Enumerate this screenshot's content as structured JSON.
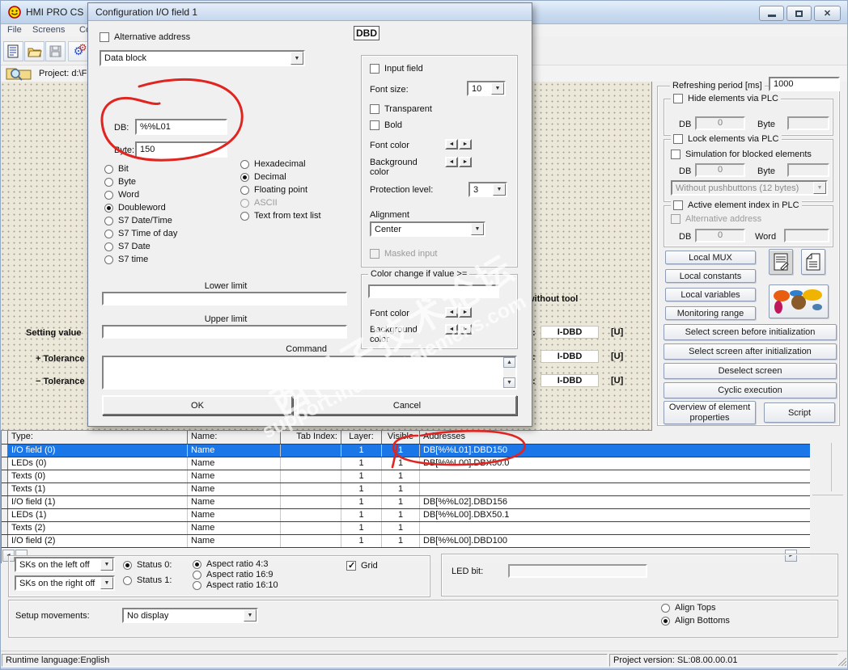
{
  "colors": {
    "highlight": "#1b76e8",
    "annotation": "#e02420",
    "canvas_bg": "#ebe8da",
    "titlebar": "#c9dbf0"
  },
  "window": {
    "title": "HMI PRO CS",
    "menu": [
      "File",
      "Screens",
      "Co"
    ],
    "project_label": "Project: d:\\F",
    "status_left": "Runtime language:English",
    "status_right": "Project version: SL:08.00.00.01"
  },
  "canvas": {
    "labels": [
      "Setting value",
      "+ Tolerance",
      "− Tolerance"
    ],
    "heading": "without tool",
    "colon": ":",
    "field_text": "I-DBD",
    "unit": "[U]"
  },
  "dialog": {
    "title": "Configuration I/O field 1",
    "alt_address": "Alternative address",
    "data_block": "Data block",
    "db_label": "DB:",
    "db_value": "%%L01",
    "byte_label": "Byte:",
    "byte_value": "150",
    "type_options": [
      "Bit",
      "Byte",
      "Word",
      "Doubleword",
      "S7 Date/Time",
      "S7 Time of day",
      "S7 Date",
      "S7 time"
    ],
    "format_options": [
      "Hexadecimal",
      "Decimal",
      "Floating point",
      "ASCII",
      "Text from text list"
    ],
    "lower_limit": "Lower limit",
    "upper_limit": "Upper limit",
    "command": "Command",
    "ok": "OK",
    "cancel": "Cancel",
    "preview": "DBD",
    "style": {
      "input_field": "Input field",
      "font_size": "Font size:",
      "font_size_value": "10",
      "transparent": "Transparent",
      "bold": "Bold",
      "font_color": "Font color",
      "background_color": "Background color",
      "protection": "Protection level:",
      "protection_value": "3",
      "alignment": "Alignment",
      "alignment_value": "Center",
      "masked": "Masked input"
    },
    "color_change": {
      "title": "Color change if value >=",
      "font_color": "Font color",
      "background_color": "Background color"
    }
  },
  "panel": {
    "refresh_label": "Refreshing period [ms]",
    "refresh_value": "1000",
    "hide_group": {
      "title": "Hide elements via PLC",
      "db": "DB",
      "db_value": "0",
      "byte": "Byte",
      "byte_value": ""
    },
    "lock_group": {
      "title": "Lock elements via PLC",
      "sim": "Simulation for blocked elements",
      "db": "DB",
      "db_value": "0",
      "byte": "Byte",
      "byte_value": "",
      "dropdown": "Without pushbuttons (12 bytes)"
    },
    "active_group": {
      "title": "Active element index in PLC",
      "alt": "Alternative address",
      "db": "DB",
      "db_value": "0",
      "word": "Word",
      "word_value": ""
    },
    "buttons": {
      "local_mux": "Local MUX",
      "local_constants": "Local constants",
      "local_variables": "Local variables",
      "monitoring_range": "Monitoring range",
      "select_before": "Select screen before initialization",
      "select_after": "Select screen after initialization",
      "deselect": "Deselect screen",
      "cyclic": "Cyclic execution",
      "overview": "Overview of element properties",
      "script": "Script"
    }
  },
  "table": {
    "headers": [
      "Type:",
      "Name:",
      "Tab Index:",
      "Layer:",
      "Visible",
      "Addresses"
    ],
    "rows": [
      {
        "type": "I/O field (0)",
        "name": "Name",
        "tab": "",
        "layer": "1",
        "visible": "1",
        "addr": "DB[%%L01].DBD150",
        "selected": true
      },
      {
        "type": "LEDs (0)",
        "name": "Name",
        "tab": "",
        "layer": "1",
        "visible": "1",
        "addr": "DB[%%L00].DBX50.0",
        "selected": false
      },
      {
        "type": "Texts (0)",
        "name": "Name",
        "tab": "",
        "layer": "1",
        "visible": "1",
        "addr": "",
        "selected": false
      },
      {
        "type": "Texts (1)",
        "name": "Name",
        "tab": "",
        "layer": "1",
        "visible": "1",
        "addr": "",
        "selected": false
      },
      {
        "type": "I/O field (1)",
        "name": "Name",
        "tab": "",
        "layer": "1",
        "visible": "1",
        "addr": "DB[%%L02].DBD156",
        "selected": false
      },
      {
        "type": "LEDs (1)",
        "name": "Name",
        "tab": "",
        "layer": "1",
        "visible": "1",
        "addr": "DB[%%L00].DBX50.1",
        "selected": false
      },
      {
        "type": "Texts (2)",
        "name": "Name",
        "tab": "",
        "layer": "1",
        "visible": "1",
        "addr": "",
        "selected": false
      },
      {
        "type": "I/O field (2)",
        "name": "Name",
        "tab": "",
        "layer": "1",
        "visible": "1",
        "addr": "DB[%%L00].DBD100",
        "selected": false
      }
    ]
  },
  "bottom": {
    "sks_left": "SKs on the left off",
    "sks_right": "SKs on the right off",
    "status0": "Status 0:",
    "status1": "Status 1:",
    "aspect43": "Aspect ratio 4:3",
    "aspect169": "Aspect ratio 16:9",
    "aspect1610": "Aspect ratio 16:10",
    "grid": "Grid",
    "led_bit": "LED bit:",
    "setup_movements": "Setup movements:",
    "setup_value": "No display",
    "align_tops": "Align Tops",
    "align_bottoms": "Align Bottoms"
  },
  "watermark": {
    "line1": "西门子技术论坛",
    "line2": "support.industry.siemens.com"
  }
}
